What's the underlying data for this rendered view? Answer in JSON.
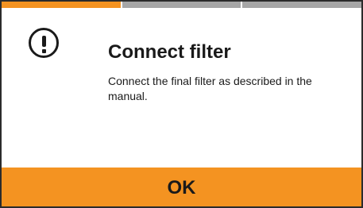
{
  "progress": {
    "total_steps": 3,
    "current_step": 1
  },
  "dialog": {
    "icon": "alert-circle-icon",
    "title": "Connect filter",
    "message": "Connect the final filter as described in the manual.",
    "ok_label": "OK"
  },
  "colors": {
    "accent": "#f49321",
    "inactive_step": "#a6a6a6",
    "text": "#1a1a1a",
    "background": "#ffffff"
  }
}
